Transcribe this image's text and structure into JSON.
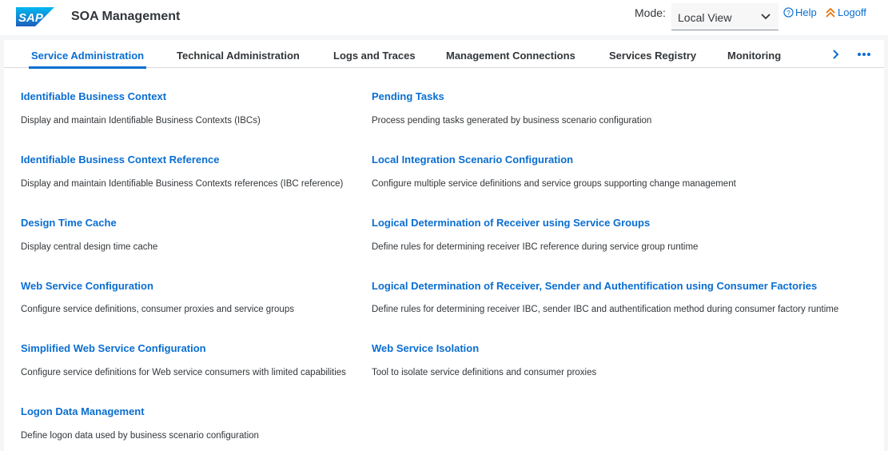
{
  "shell": {
    "logo_text": "SAP",
    "title": "SOA Management",
    "mode_label": "Mode:",
    "mode_value": "Local View",
    "help_label": "Help",
    "logoff_label": "Logoff"
  },
  "tabs": [
    {
      "label": "Service Administration",
      "active": true
    },
    {
      "label": "Technical Administration",
      "active": false
    },
    {
      "label": "Logs and Traces",
      "active": false
    },
    {
      "label": "Management Connections",
      "active": false
    },
    {
      "label": "Services Registry",
      "active": false
    },
    {
      "label": "Monitoring",
      "active": false
    }
  ],
  "left_items": [
    {
      "title": "Identifiable Business Context",
      "desc": "Display and maintain Identifiable Business Contexts (IBCs)"
    },
    {
      "title": "Identifiable Business Context Reference",
      "desc": "Display and maintain Identifiable Business Contexts references (IBC reference)"
    },
    {
      "title": "Design Time Cache",
      "desc": "Display central design time cache"
    },
    {
      "title": "Web Service Configuration",
      "desc": "Configure service definitions, consumer proxies and service groups"
    },
    {
      "title": "Simplified Web Service Configuration",
      "desc": "Configure service definitions for Web service consumers with limited capabilities"
    },
    {
      "title": "Logon Data Management",
      "desc": "Define logon data used by business scenario configuration"
    }
  ],
  "right_items": [
    {
      "title": "Pending Tasks",
      "desc": "Process pending tasks generated by business scenario configuration"
    },
    {
      "title": "Local Integration Scenario Configuration",
      "desc": "Configure multiple service definitions and service groups supporting change management"
    },
    {
      "title": "Logical Determination of Receiver using Service Groups",
      "desc": "Define rules for determining receiver IBC reference during service group runtime"
    },
    {
      "title": "Logical Determination of Receiver, Sender and Authentification using Consumer Factories",
      "desc": "Define rules for determining receiver IBC, sender IBC and authentification method during consumer factory runtime"
    },
    {
      "title": "Web Service Isolation",
      "desc": "Tool to isolate service definitions and consumer proxies"
    }
  ],
  "colors": {
    "accent": "#0a6ed1",
    "logoff_icon": "#e9730c",
    "sap_blue": "#0a6ed1"
  },
  "icons": [
    "sap-logo",
    "chevron-down-icon",
    "help-icon",
    "logoff-icon",
    "chevron-right-icon",
    "overflow-icon"
  ]
}
